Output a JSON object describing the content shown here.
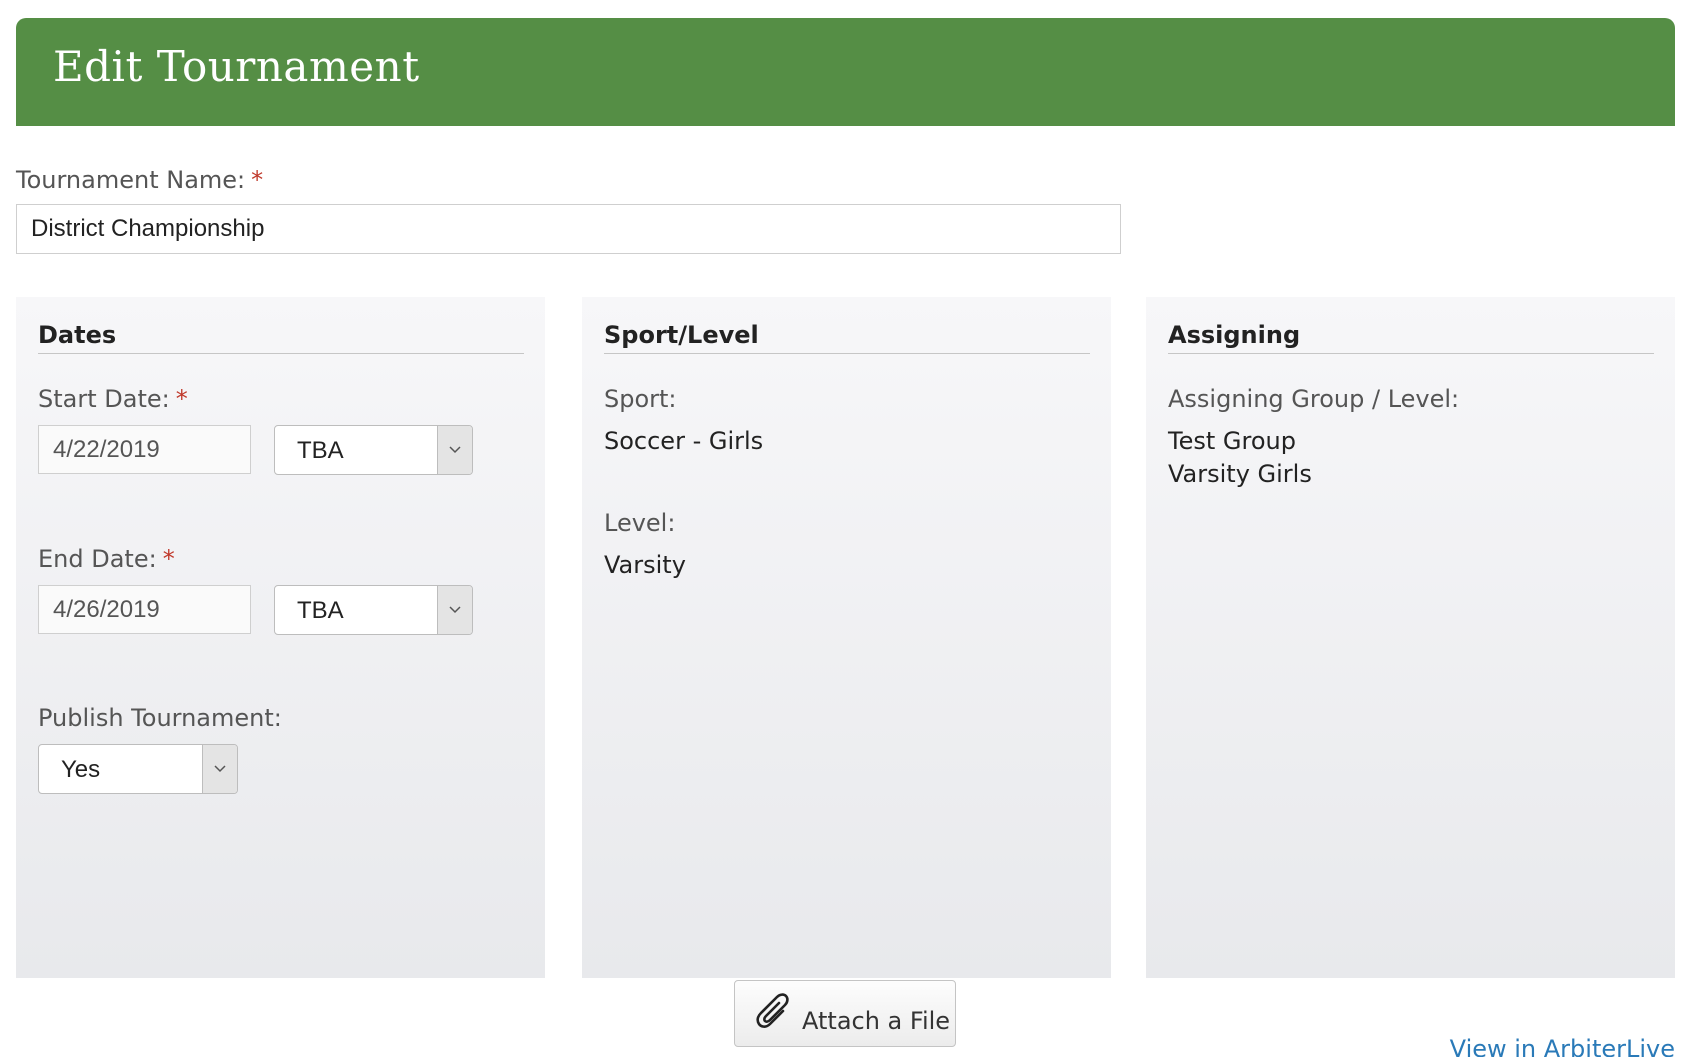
{
  "header": {
    "title": "Edit Tournament"
  },
  "tournament_name": {
    "label": "Tournament Name:",
    "required": "*",
    "value": "District Championship"
  },
  "dates": {
    "title": "Dates",
    "start_label": "Start Date:",
    "start_required": "*",
    "start_value": "4/22/2019",
    "start_time": "TBA",
    "end_label": "End Date:",
    "end_required": "*",
    "end_value": "4/26/2019",
    "end_time": "TBA",
    "publish_label": "Publish Tournament:",
    "publish_value": "Yes"
  },
  "sport_level": {
    "title": "Sport/Level",
    "sport_label": "Sport:",
    "sport_value": "Soccer - Girls",
    "level_label": "Level:",
    "level_value": "Varsity"
  },
  "assigning": {
    "title": "Assigning",
    "group_label": "Assigning Group / Level:",
    "group_value": "Test Group",
    "level_value": "Varsity Girls"
  },
  "actions": {
    "attach_label": "Attach a File",
    "attach_icon": "paperclip-icon",
    "view_link": "View in ArbiterLive"
  },
  "colors": {
    "header_bg": "#558e45",
    "required": "#c0392b",
    "link": "#2a7ab8"
  }
}
